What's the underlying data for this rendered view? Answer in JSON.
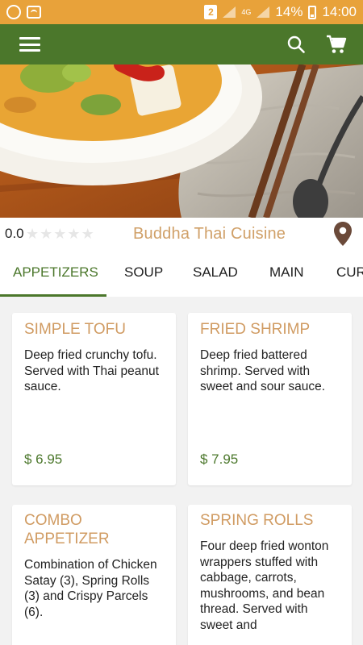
{
  "status_bar": {
    "notification_count": "2",
    "network": "4G",
    "battery": "14%",
    "time": "14:00"
  },
  "app_bar": {
    "icons": [
      "menu-icon",
      "search-icon",
      "cart-icon"
    ]
  },
  "restaurant": {
    "rating": "0.0",
    "stars_filled": 0,
    "stars_total": 5,
    "name": "Buddha Thai Cuisine"
  },
  "tabs": [
    {
      "label": "APPETIZERS",
      "active": true
    },
    {
      "label": "SOUP",
      "active": false
    },
    {
      "label": "SALAD",
      "active": false
    },
    {
      "label": "MAIN",
      "active": false
    },
    {
      "label": "CUR",
      "active": false
    }
  ],
  "menu_items": [
    {
      "title": "SIMPLE TOFU",
      "description": "Deep fried crunchy tofu. Served with Thai peanut sauce.",
      "price": "$ 6.95"
    },
    {
      "title": "FRIED SHRIMP",
      "description": "Deep fried battered shrimp. Served with sweet and sour sauce.",
      "price": "$ 7.95"
    },
    {
      "title": "COMBO APPETIZER",
      "description": "Combination of Chicken Satay (3), Spring Rolls (3) and Crispy Parcels (6).",
      "price": ""
    },
    {
      "title": "SPRING ROLLS",
      "description": "Four deep fried wonton wrappers stuffed with cabbage, carrots, mushrooms, and bean thread. Served with sweet and",
      "price": ""
    }
  ],
  "colors": {
    "status_bar": "#e8a23a",
    "app_bar": "#4b772b",
    "accent_green": "#4b772b",
    "title_tan": "#d09b62",
    "restaurant_name": "#d0a068",
    "location_pin": "#6b4a3a"
  }
}
